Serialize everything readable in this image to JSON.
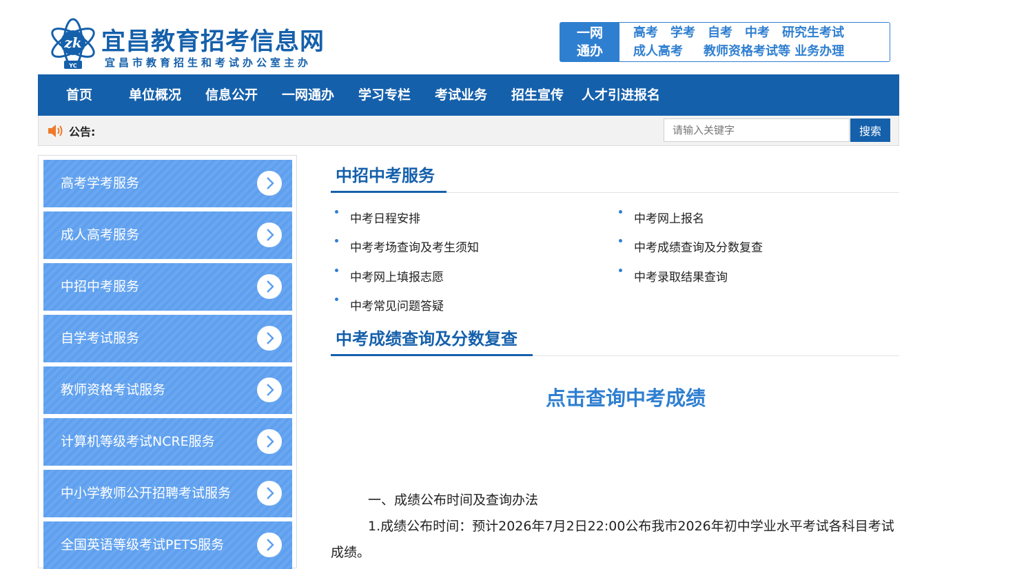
{
  "header": {
    "title": "宜昌教育招考信息网",
    "subtitle": "宜昌市教育招生和考试办公室主办",
    "logo_text": "zk",
    "logo_sub": "YC",
    "oneweb": {
      "tag_line1": "一网",
      "tag_line2": "通办",
      "row1": [
        "高考",
        "学考",
        "自考",
        "中考",
        "研究生考试"
      ],
      "row2": [
        "成人高考",
        "教师资格考试等 业务办理"
      ]
    }
  },
  "nav": {
    "items": [
      "首页",
      "单位概况",
      "信息公开",
      "一网通办",
      "学习专栏",
      "考试业务",
      "招生宣传",
      "人才引进报名"
    ]
  },
  "notice": {
    "label": "公告:",
    "search_placeholder": "请输入关键字",
    "search_button": "搜索"
  },
  "sidebar": {
    "items": [
      "高考学考服务",
      "成人高考服务",
      "中招中考服务",
      "自学考试服务",
      "教师资格考试服务",
      "计算机等级考试NCRE服务",
      "中小学教师公开招聘考试服务",
      "全国英语等级考试PETS服务"
    ]
  },
  "main": {
    "section1_title": "中招中考服务",
    "links": [
      "中考日程安排",
      "中考网上报名",
      "中考考场查询及考生须知",
      "中考成绩查询及分数复查",
      "中考网上填报志愿",
      "中考录取结果查询",
      "中考常见问题答疑"
    ],
    "section2_title": "中考成绩查询及分数复查",
    "query_link": "点击查询中考成绩",
    "para1": "一、成绩公布时间及查询办法",
    "para2": "1.成绩公布时间：预计2026年7月2日22:00公布我市2026年初中学业水平考试各科目考试成绩。"
  },
  "colors": {
    "primary": "#1560ab",
    "accent": "#2f7fd0",
    "sidebar_item": "#5ea0ef"
  }
}
